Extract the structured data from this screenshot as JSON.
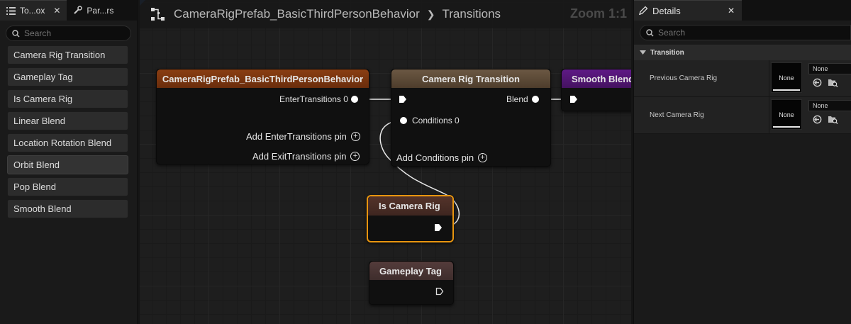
{
  "left_panel": {
    "tabs": [
      {
        "label": "To...ox",
        "close": "✕"
      },
      {
        "label": "Par...rs"
      }
    ],
    "search_placeholder": "Search",
    "items": [
      {
        "label": "Camera Rig Transition"
      },
      {
        "label": "Gameplay Tag"
      },
      {
        "label": "Is Camera Rig"
      },
      {
        "label": "Linear Blend"
      },
      {
        "label": "Location Rotation Blend"
      },
      {
        "label": "Orbit Blend"
      },
      {
        "label": "Pop Blend"
      },
      {
        "label": "Smooth Blend"
      }
    ]
  },
  "graph": {
    "breadcrumb": {
      "asset": "CameraRigPrefab_BasicThirdPersonBehavior",
      "separator": "❯",
      "current": "Transitions"
    },
    "zoom": "Zoom 1:1",
    "nodes": {
      "root": {
        "title": "CameraRigPrefab_BasicThirdPersonBehavior",
        "header_color": "#7a3510",
        "enter_pin": "EnterTransitions 0",
        "add_enter": "Add EnterTransitions pin",
        "add_exit": "Add ExitTransitions pin"
      },
      "transition": {
        "title": "Camera Rig Transition",
        "header_color": "#5e4a36",
        "blend_pin": "Blend",
        "conditions_pin": "Conditions 0",
        "add_conditions": "Add Conditions pin"
      },
      "smooth_blend": {
        "title": "Smooth Blend",
        "header_color": "#4f1670"
      },
      "is_camera_rig": {
        "title": "Is Camera Rig",
        "header_color": "#4a2a22",
        "selected_color": "#e8950f"
      },
      "gameplay_tag": {
        "title": "Gameplay Tag",
        "header_color": "#4a3534"
      }
    }
  },
  "details": {
    "tab_label": "Details",
    "close": "✕",
    "search_placeholder": "Search",
    "category": "Transition",
    "properties": [
      {
        "name": "Previous Camera Rig",
        "thumb": "None",
        "value": "None"
      },
      {
        "name": "Next Camera Rig",
        "thumb": "None",
        "value": "None"
      }
    ]
  }
}
